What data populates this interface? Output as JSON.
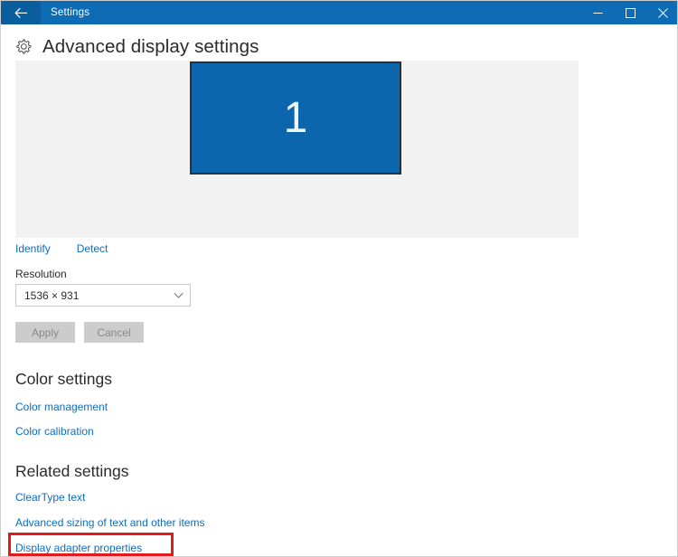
{
  "window": {
    "title": "Settings",
    "back_icon": "back-arrow-icon",
    "controls": {
      "minimize": "minimize-icon",
      "maximize": "maximize-icon",
      "close": "close-icon"
    },
    "accent_color": "#0d6cb3",
    "back_button_color": "#0a5e9e"
  },
  "page": {
    "icon": "gear-icon",
    "title": "Advanced display settings"
  },
  "display_preview": {
    "panel_color": "#f2f2f2",
    "monitor_color": "#0b66ae",
    "monitor_border_color": "#2f2f2f",
    "monitor_label": "1",
    "identify_label": "Identify",
    "detect_label": "Detect"
  },
  "resolution": {
    "label": "Resolution",
    "value": "1536 × 931",
    "chevron_icon": "chevron-down-icon",
    "options": [
      "1536 × 931"
    ]
  },
  "actions": {
    "apply_label": "Apply",
    "cancel_label": "Cancel",
    "disabled_bg": "#cccccc",
    "disabled_text": "#8a8a8a"
  },
  "color_settings": {
    "heading": "Color settings",
    "links": [
      {
        "label": "Color management"
      },
      {
        "label": "Color calibration"
      }
    ]
  },
  "related_settings": {
    "heading": "Related settings",
    "links": [
      {
        "label": "ClearType text"
      },
      {
        "label": "Advanced sizing of text and other items"
      },
      {
        "label": "Display adapter properties"
      }
    ]
  },
  "annotation": {
    "target": "Display adapter properties",
    "color": "#e01b1b"
  },
  "theme": {
    "link_color": "#0a6cc4",
    "text_color": "#2b2b2b",
    "page_bg": "#ffffff"
  }
}
